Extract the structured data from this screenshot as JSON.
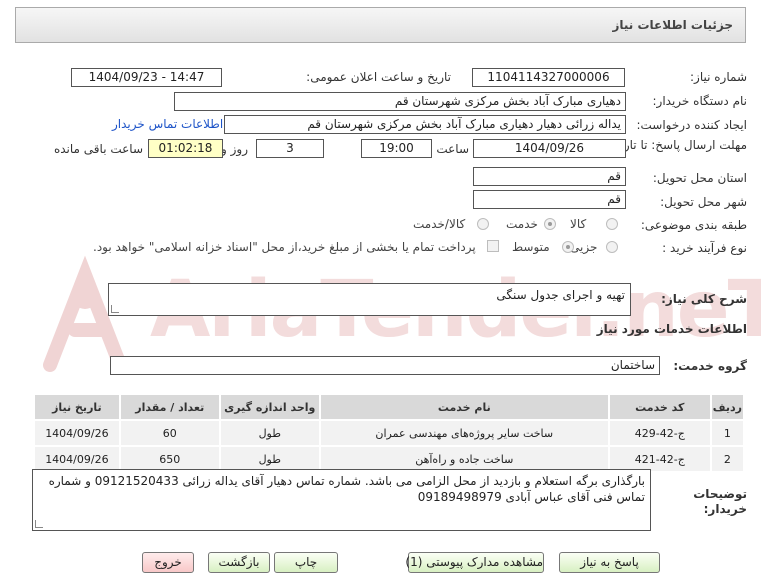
{
  "header": {
    "title": "جزئیات اطلاعات نیاز"
  },
  "form": {
    "need_number_label": "شماره نیاز:",
    "need_number": "1104114327000006",
    "announce_label": "تاریخ و ساعت اعلان عمومی:",
    "announce_value": "1404/09/23 - 14:47",
    "buyer_org_label": "نام دستگاه خریدار:",
    "buyer_org": "دهیاری مبارک آباد بخش مرکزی  شهرستان قم",
    "requester_label": "ایجاد کننده درخواست:",
    "requester": "یداله زرائی دهیار  دهیاری مبارک آباد بخش مرکزی  شهرستان قم",
    "contact_link": "اطلاعات تماس خریدار",
    "deadline_label": "مهلت ارسال پاسخ: تا تاریخ:",
    "deadline_date": "1404/09/26",
    "hour_label": "ساعت",
    "deadline_time": "19:00",
    "days_value": "3",
    "days_label": "روز و",
    "remaining_time": "01:02:18",
    "remaining_label": "ساعت باقی مانده",
    "province_label": "استان محل تحویل:",
    "province": "قم",
    "city_label": "شهر محل تحویل:",
    "city": "قم",
    "category_label": "طبقه بندی موضوعی:",
    "category_options": [
      "کالا",
      "خدمت",
      "کالا/خدمت"
    ],
    "category_selected": "خدمت",
    "purchase_type_label": "نوع فرآیند خرید :",
    "purchase_type_options": [
      "جزیی",
      "متوسط"
    ],
    "purchase_type_selected": "متوسط",
    "treasury_note": "پرداخت تمام یا بخشی از مبلغ خرید،از محل \"اسناد خزانه اسلامی\" خواهد بود."
  },
  "description": {
    "label": "شرح کلی نیاز:",
    "value": "تهیه و اجرای جدول سنگی"
  },
  "services": {
    "section_title": "اطلاعات خدمات مورد نیاز",
    "group_label": "گروه خدمت:",
    "group_value": "ساختمان",
    "columns": [
      "ردیف",
      "کد خدمت",
      "نام خدمت",
      "واحد اندازه گیری",
      "تعداد / مقدار",
      "تاریخ نیاز"
    ],
    "rows": [
      [
        "1",
        "ج-42-429",
        "ساخت سایر پروژه‌های مهندسی عمران",
        "طول",
        "60",
        "1404/09/26"
      ],
      [
        "2",
        "ج-42-421",
        "ساخت جاده و راه‌آهن",
        "طول",
        "650",
        "1404/09/26"
      ]
    ]
  },
  "buyer_notes": {
    "label": "توضیحات خریدار:",
    "value": "بارگذاری برگه استعلام و بازدید از محل الزامی می باشد. شماره تماس دهیار آقای یداله زرائی 09121520433 و شماره تماس فنی آقای عباس آبادی 09189498979"
  },
  "buttons": {
    "reply": "پاسخ به نیاز",
    "attachments": "مشاهده مدارک پیوستی (1)",
    "print": "چاپ",
    "back": "بازگشت",
    "exit": "خروج"
  },
  "watermark": {
    "text": "AriaTender.neT"
  },
  "colors": {
    "link": "#1e54c8",
    "remaining_bg": "#ffffc6",
    "button_bg": "#d8f0c2",
    "exit_bg": "#f8c8c8",
    "watermark": "#f0d0d0"
  }
}
